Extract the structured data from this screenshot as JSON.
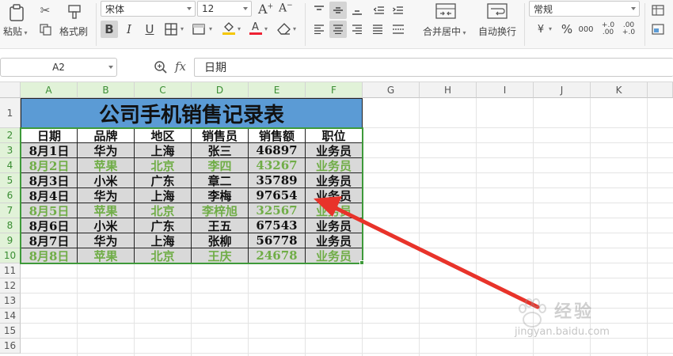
{
  "toolbar": {
    "paste_label": "粘贴",
    "format_painter_label": "格式刷",
    "font_name": "宋体",
    "font_size": "12",
    "bold_label": "B",
    "italic_label": "I",
    "underline_label": "U",
    "merge_center_label": "合并居中",
    "wrap_text_label": "自动换行",
    "number_format": "常规",
    "percent_label": "%",
    "thousands_label": "000",
    "increase_decimal_label": "+.0\n.00",
    "decrease_decimal_label": ".00\n+.0"
  },
  "formula_bar": {
    "cell_ref": "A2",
    "fx_label": "fx",
    "content": "日期"
  },
  "columns": [
    "A",
    "B",
    "C",
    "D",
    "E",
    "F",
    "G",
    "H",
    "I",
    "J",
    "K"
  ],
  "rows": [
    "1",
    "2",
    "3",
    "4",
    "5",
    "6",
    "7",
    "8",
    "9",
    "10",
    "11",
    "12",
    "13",
    "14",
    "15",
    "16"
  ],
  "table": {
    "title": "公司手机销售记录表",
    "headers": [
      "日期",
      "品牌",
      "地区",
      "销售员",
      "销售额",
      "职位"
    ],
    "rows": [
      [
        "8月1日",
        "华为",
        "上海",
        "张三",
        "46897",
        "业务员"
      ],
      [
        "8月2日",
        "苹果",
        "北京",
        "李四",
        "43267",
        "业务员"
      ],
      [
        "8月3日",
        "小米",
        "广东",
        "章二",
        "35789",
        "业务员"
      ],
      [
        "8月4日",
        "华为",
        "上海",
        "李梅",
        "97654",
        "业务员"
      ],
      [
        "8月5日",
        "苹果",
        "北京",
        "李梓旭",
        "32567",
        "业务员"
      ],
      [
        "8月6日",
        "小米",
        "广东",
        "王五",
        "67543",
        "业务员"
      ],
      [
        "8月7日",
        "华为",
        "上海",
        "张柳",
        "56778",
        "业务员"
      ],
      [
        "8月8日",
        "苹果",
        "北京",
        "王庆",
        "24678",
        "业务员"
      ]
    ],
    "highlight_rows": [
      1,
      4,
      7
    ]
  },
  "colors": {
    "title_bg": "#5b9bd5",
    "cell_bg": "#d9d9d9",
    "highlight_text": "#70ad47",
    "selection": "#3e9a3a",
    "arrow": "#e8332a"
  },
  "watermark": {
    "brand_text": "经验",
    "url_text": "jingyan.baidu.com"
  }
}
